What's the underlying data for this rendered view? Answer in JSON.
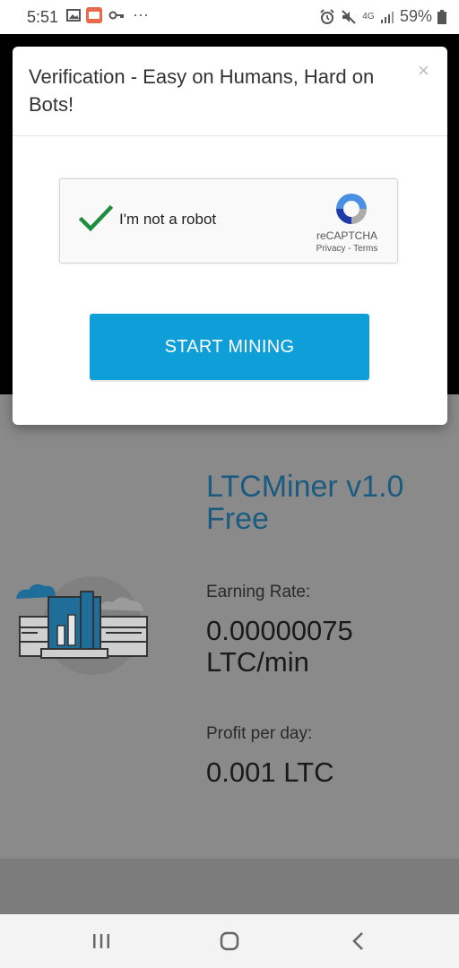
{
  "status_bar": {
    "time": "5:51",
    "dots": "···",
    "network": "4G",
    "battery": "59%",
    "icons": [
      "image-icon",
      "app-icon",
      "key-icon",
      "alarm-icon",
      "mute-icon",
      "network-icon",
      "signal-icon",
      "battery-icon"
    ]
  },
  "modal": {
    "title": "Verification - Easy on Humans, Hard on Bots!",
    "close": "×",
    "captcha": {
      "label": "I'm not a robot",
      "brand": "reCAPTCHA",
      "links": "Privacy - Terms",
      "checked": true
    },
    "button_label": "START MINING"
  },
  "app": {
    "title": "LTCMiner v1.0 Free",
    "earning_rate_label": "Earning Rate:",
    "earning_rate_value": "0.00000075 LTC/min",
    "profit_label": "Profit per day:",
    "profit_value": "0.001 LTC"
  },
  "colors": {
    "accent": "#0f9fd8",
    "title": "#1b5b7f",
    "check": "#1e8e3e",
    "app_bg": "#8a8a8a"
  },
  "nav": [
    "recent-apps-icon",
    "home-icon",
    "back-icon"
  ]
}
